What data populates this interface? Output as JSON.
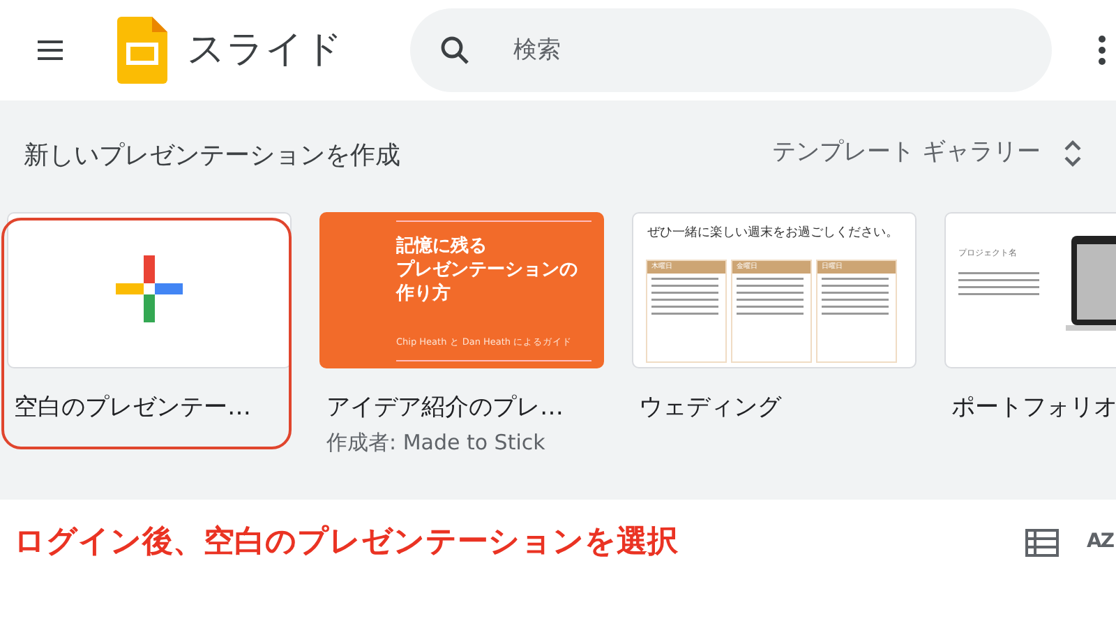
{
  "header": {
    "app_title": "スライド",
    "search": {
      "placeholder": "検索"
    }
  },
  "section": {
    "title": "新しいプレゼンテーションを作成",
    "gallery_button": "テンプレート ギャラリー"
  },
  "templates": [
    {
      "kind": "blank",
      "name": "空白のプレゼンテー…",
      "selected": true
    },
    {
      "kind": "orange",
      "name": "アイデア紹介のプレ…",
      "author": "作成者: Made to Stick",
      "thumb_title_lines": [
        "記憶に残る",
        "プレゼンテーションの",
        "作り方"
      ],
      "thumb_subtitle": "Chip Heath と Dan Heath によるガイド",
      "selected": false
    },
    {
      "kind": "wedding",
      "name": "ウェディング",
      "thumb_title": "ぜひ一緒に楽しい週末をお過ごしください。",
      "thumb_columns": [
        "木曜日",
        "金曜日",
        "日曜日"
      ],
      "selected": false
    },
    {
      "kind": "portfolio",
      "name": "ポートフォリオ",
      "thumb_title": "プロジェクト名",
      "selected": false
    }
  ],
  "annotation": "ログイン後、空白のプレゼンテーションを選択",
  "toolbar": {
    "sort_label": "AZ"
  }
}
